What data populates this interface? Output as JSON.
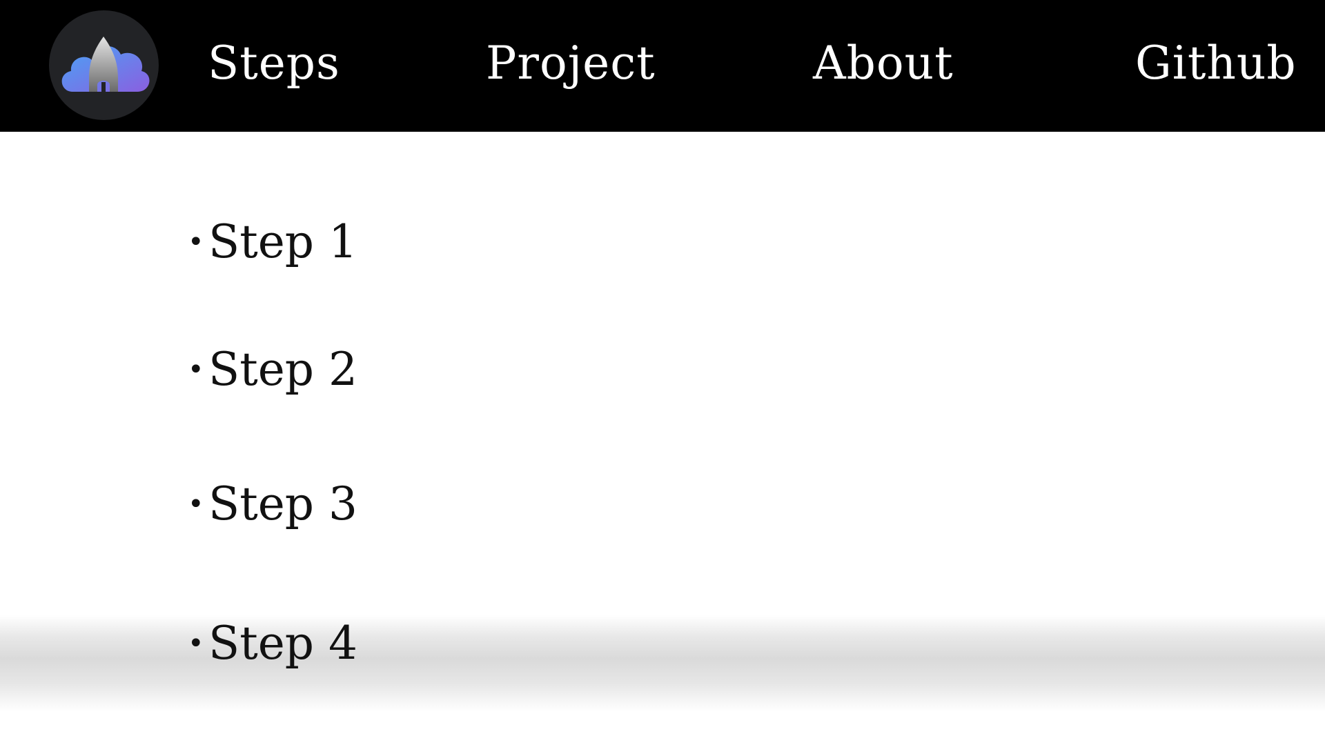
{
  "nav": {
    "logo_icon": "cloud-rocket-icon",
    "items": [
      {
        "label": "Steps"
      },
      {
        "label": "Project"
      },
      {
        "label": "About"
      },
      {
        "label": "Github"
      }
    ]
  },
  "steps": {
    "bullet": "•",
    "items": [
      {
        "label": "Step 1"
      },
      {
        "label": "Step 2"
      },
      {
        "label": "Step 3"
      },
      {
        "label": "Step 4"
      }
    ]
  },
  "colors": {
    "navbar_bg": "#000000",
    "logo_circle": "#222326",
    "cloud_blue": "#5b8ef0",
    "cloud_purple": "#8a6de6",
    "page_bg": "#ffffff",
    "text_dark": "#111111"
  }
}
